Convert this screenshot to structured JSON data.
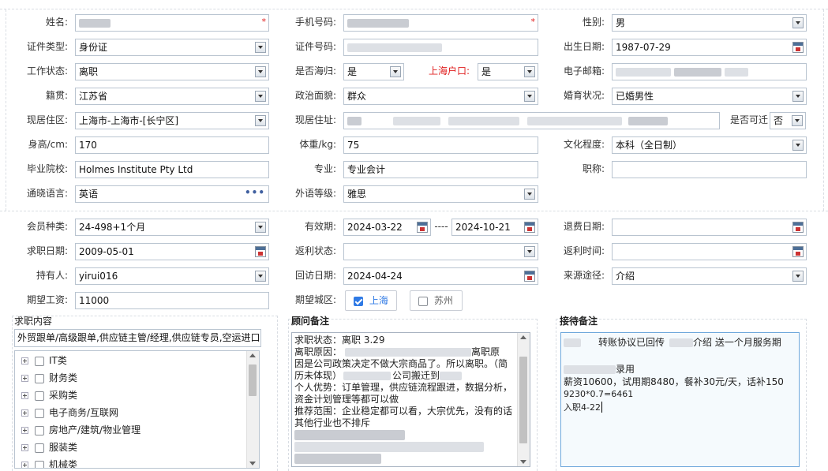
{
  "basic": {
    "name_label": "姓名:",
    "phone_label": "手机号码:",
    "gender_label": "性别:",
    "gender_value": "男",
    "id_type_label": "证件类型:",
    "id_type_value": "身份证",
    "id_no_label": "证件号码:",
    "birth_label": "出生日期:",
    "birth_value": "1987-07-29",
    "work_status_label": "工作状态:",
    "work_status_value": "离职",
    "overseas_label": "是否海归:",
    "overseas_value": "是",
    "hukou_label": "上海户口:",
    "hukou_value": "是",
    "email_label": "电子邮箱:",
    "native_label": "籍贯:",
    "native_value": "江苏省",
    "politics_label": "政治面貌:",
    "politics_value": "群众",
    "marital_label": "婚育状况:",
    "marital_value": "已婚男性",
    "region_label": "现居住区:",
    "region_value": "上海市-上海市-[长宁区]",
    "address_label": "现居住址:",
    "relocate_label": "是否可迁",
    "relocate_value": "否",
    "height_label": "身高/cm:",
    "height_value": "170",
    "weight_label": "体重/kg:",
    "weight_value": "75",
    "education_label": "文化程度:",
    "education_value": "本科（全日制）",
    "school_label": "毕业院校:",
    "school_value": "Holmes Institute Pty Ltd",
    "major_label": "专业:",
    "major_value": "专业会计",
    "title_label": "职称:",
    "title_value": "",
    "language_label": "通晓语言:",
    "language_value": "英语",
    "lang_level_label": "外语等级:",
    "lang_level_value": "雅思",
    "more_glyph": "•••",
    "required_mark": "*"
  },
  "membership": {
    "type_label": "会员种类:",
    "type_value": "24-498+1个月",
    "valid_label": "有效期:",
    "valid_from": "2024-03-22",
    "valid_sep": "----",
    "valid_to": "2024-10-21",
    "refund_label": "退费日期:",
    "refund_value": "",
    "apply_label": "求职日期:",
    "apply_value": "2009-05-01",
    "rebate_status_label": "返利状态:",
    "rebate_status_value": "",
    "rebate_time_label": "返利时间:",
    "rebate_time_value": "",
    "holder_label": "持有人:",
    "holder_value": "yirui016",
    "visit_label": "回访日期:",
    "visit_value": "2024-04-24",
    "source_label": "来源途径:",
    "source_value": "介绍",
    "salary_label": "期望工资:",
    "salary_value": "11000",
    "city_label": "期望城区:",
    "city_options": [
      {
        "label": "上海",
        "checked": true
      },
      {
        "label": "苏州",
        "checked": false
      }
    ]
  },
  "job": {
    "title": "求职内容",
    "content_value": "外贸跟单/高级跟单,供应链主管/经理,供应链专员,空运进口",
    "tree": [
      "IT类",
      "财务类",
      "采购类",
      "电子商务/互联网",
      "房地产/建筑/物业管理",
      "服装类",
      "机械类"
    ]
  },
  "consultant": {
    "title": "顾问备注",
    "lines": [
      "求职状态：离职  3.29",
      "离职原因：",
      "因是公司政策决定不做大宗商品了。所以离职。（简",
      "历未体现）",
      "个人优势：订单管理，供应链流程跟进，数据分析，",
      "资金计划管理等都可以做",
      "推荐范围：企业稳定都可以看，大宗优先，没有的话",
      "其他行业也不排斥"
    ],
    "line2_tail": "离职原",
    "line4_mid": "公司搬迁到"
  },
  "reception": {
    "title": "接待备注",
    "line1_a": "转账协议已回传",
    "line1_b": "介绍 送一个月服务期",
    "line2_tail": "录用",
    "line3": "薪资10600，试用期8480，餐补30元/天，话补150",
    "line4": "9230*0.7=6461",
    "line5": "入职4-22"
  }
}
